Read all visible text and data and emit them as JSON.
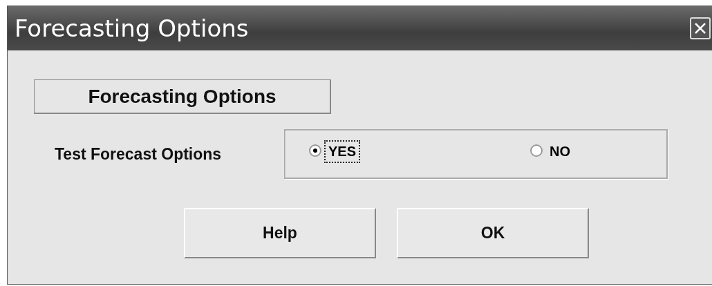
{
  "window": {
    "title": "Forecasting Options"
  },
  "frame_label": "Forecasting Options",
  "option": {
    "label": "Test Forecast Options",
    "choices": [
      {
        "label": "YES",
        "selected": true,
        "focused": true
      },
      {
        "label": "NO",
        "selected": false,
        "focused": false
      }
    ]
  },
  "buttons": [
    "Help",
    "OK"
  ]
}
